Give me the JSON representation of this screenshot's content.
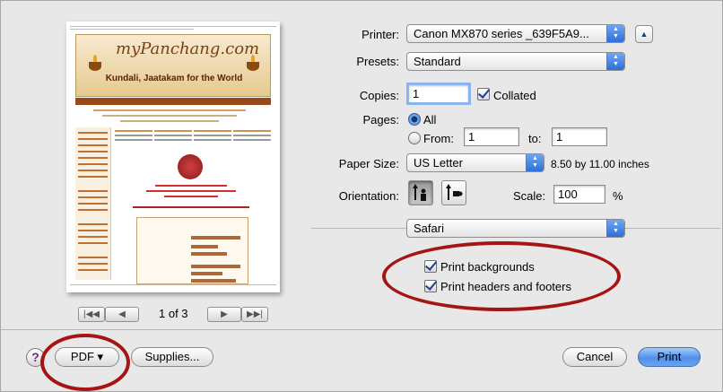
{
  "printer": {
    "label": "Printer:",
    "value": "Canon MX870 series _639F5A9..."
  },
  "presets": {
    "label": "Presets:",
    "value": "Standard"
  },
  "copies": {
    "label": "Copies:",
    "value": "1",
    "collated_label": "Collated",
    "collated": true
  },
  "pages": {
    "label": "Pages:",
    "all_label": "All",
    "from_label": "From:",
    "from_value": "1",
    "to_label": "to:",
    "to_value": "1"
  },
  "paper": {
    "label": "Paper Size:",
    "value": "US Letter",
    "dimensions": "8.50 by 11.00 inches"
  },
  "orientation": {
    "label": "Orientation:"
  },
  "scale": {
    "label": "Scale:",
    "value": "100",
    "unit": "%"
  },
  "section": {
    "value": "Safari"
  },
  "options": [
    {
      "label": "Print backgrounds",
      "checked": true
    },
    {
      "label": "Print headers and footers",
      "checked": true
    }
  ],
  "pagination": {
    "label": "1 of 3"
  },
  "buttons": {
    "help": "?",
    "pdf": "PDF ▾",
    "supplies": "Supplies...",
    "cancel": "Cancel",
    "print": "Print"
  },
  "preview": {
    "logo": "myPanchang.com",
    "tagline": "Kundali, Jaatakam for the World"
  },
  "colors": {
    "accent": "#4f90ea",
    "annotation": "#a51515"
  }
}
